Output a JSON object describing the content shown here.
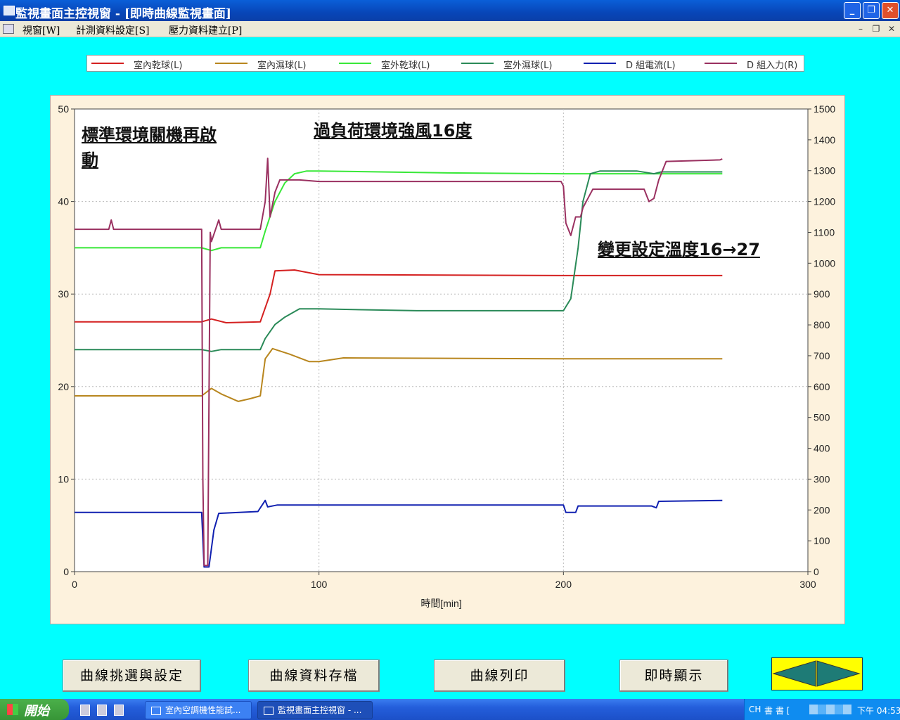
{
  "window": {
    "title": "監視畫面主控視窗 - [即時曲線監視畫面]",
    "minimize": "_",
    "restore": "❐",
    "close": "✕"
  },
  "menu": {
    "items": [
      "視窗[W]",
      "計測資料設定[S]",
      "壓力資料建立[P]"
    ],
    "mdi_min": "–",
    "mdi_restore": "❐",
    "mdi_close": "✕"
  },
  "legend": [
    {
      "label": "室內乾球(L)",
      "color": "#d42020"
    },
    {
      "label": "室內濕球(L)",
      "color": "#b8861e"
    },
    {
      "label": "室外乾球(L)",
      "color": "#38e838"
    },
    {
      "label": "室外濕球(L)",
      "color": "#2a8a58"
    },
    {
      "label": "D 組電流(L)",
      "color": "#1020b0"
    },
    {
      "label": "D 組入力(R)",
      "color": "#9a3060"
    }
  ],
  "annotations": {
    "a1_line1": "標準環境關機再啟",
    "a1_line2": "動",
    "a2": "過負荷環境強風16度",
    "a3": "變更設定溫度16→27"
  },
  "chart_data": {
    "type": "line",
    "xlabel": "時間[min]",
    "xlim": [
      0,
      300
    ],
    "ylim_left": [
      0,
      50
    ],
    "ylim_right": [
      0,
      1500
    ],
    "x_ticks": [
      0,
      100,
      200,
      300
    ],
    "y_left_ticks": [
      0,
      10,
      20,
      30,
      40,
      50
    ],
    "y_right_ticks": [
      0,
      100,
      200,
      300,
      400,
      500,
      600,
      700,
      800,
      900,
      1000,
      1100,
      1200,
      1300,
      1400,
      1500
    ],
    "grid": true,
    "series": [
      {
        "name": "室內乾球(L)",
        "axis": "left",
        "color": "#d42020",
        "points": [
          [
            0,
            27
          ],
          [
            52,
            27
          ],
          [
            56,
            27.3
          ],
          [
            62,
            26.9
          ],
          [
            76,
            27
          ],
          [
            80,
            30
          ],
          [
            82,
            32.5
          ],
          [
            90,
            32.6
          ],
          [
            100,
            32.1
          ],
          [
            200,
            32
          ],
          [
            265,
            32
          ]
        ]
      },
      {
        "name": "室內濕球(L)",
        "axis": "left",
        "color": "#b8861e",
        "points": [
          [
            0,
            19
          ],
          [
            52,
            19
          ],
          [
            56,
            19.8
          ],
          [
            60,
            19.2
          ],
          [
            67,
            18.4
          ],
          [
            72,
            18.7
          ],
          [
            76,
            19
          ],
          [
            78,
            23
          ],
          [
            81,
            24.1
          ],
          [
            88,
            23.5
          ],
          [
            96,
            22.7
          ],
          [
            100,
            22.7
          ],
          [
            110,
            23.1
          ],
          [
            200,
            23
          ],
          [
            265,
            23
          ]
        ]
      },
      {
        "name": "室外乾球(L)",
        "axis": "left",
        "color": "#38e838",
        "points": [
          [
            0,
            35
          ],
          [
            52,
            35
          ],
          [
            56,
            34.7
          ],
          [
            60,
            35
          ],
          [
            76,
            35
          ],
          [
            78,
            36.8
          ],
          [
            82,
            40
          ],
          [
            86,
            42
          ],
          [
            90,
            43
          ],
          [
            95,
            43.3
          ],
          [
            100,
            43.3
          ],
          [
            150,
            43.1
          ],
          [
            200,
            43
          ],
          [
            265,
            43
          ]
        ]
      },
      {
        "name": "室外濕球(L)",
        "axis": "left",
        "color": "#2a8a58",
        "points": [
          [
            0,
            24
          ],
          [
            52,
            24
          ],
          [
            56,
            23.8
          ],
          [
            60,
            24
          ],
          [
            76,
            24
          ],
          [
            78,
            25.2
          ],
          [
            82,
            26.7
          ],
          [
            86,
            27.5
          ],
          [
            92,
            28.4
          ],
          [
            100,
            28.4
          ],
          [
            140,
            28.2
          ],
          [
            200,
            28.2
          ],
          [
            203,
            29.5
          ],
          [
            206,
            35
          ],
          [
            208,
            40
          ],
          [
            211,
            43
          ],
          [
            215,
            43.3
          ],
          [
            230,
            43.3
          ],
          [
            237,
            43
          ],
          [
            240,
            43.2
          ],
          [
            265,
            43.2
          ]
        ]
      },
      {
        "name": "D 組電流(L)",
        "axis": "left",
        "color": "#1020b0",
        "points": [
          [
            0,
            6.4
          ],
          [
            52,
            6.4
          ],
          [
            53,
            0.5
          ],
          [
            55,
            0.5
          ],
          [
            57,
            4.5
          ],
          [
            59,
            6.3
          ],
          [
            75,
            6.5
          ],
          [
            78,
            7.7
          ],
          [
            79,
            7
          ],
          [
            83,
            7.2
          ],
          [
            100,
            7.2
          ],
          [
            200,
            7.2
          ],
          [
            201,
            6.4
          ],
          [
            205,
            6.4
          ],
          [
            206,
            7.1
          ],
          [
            236,
            7.1
          ],
          [
            238,
            6.9
          ],
          [
            239,
            7.6
          ],
          [
            265,
            7.7
          ]
        ]
      },
      {
        "name": "D 組入力(R)",
        "axis": "right",
        "color": "#9a3060",
        "points": [
          [
            0,
            1110
          ],
          [
            14,
            1110
          ],
          [
            15,
            1140
          ],
          [
            16,
            1110
          ],
          [
            52,
            1110
          ],
          [
            52.5,
            300
          ],
          [
            53,
            20
          ],
          [
            54.5,
            20
          ],
          [
            55.5,
            1100
          ],
          [
            56,
            1070
          ],
          [
            59,
            1140
          ],
          [
            60,
            1110
          ],
          [
            76,
            1110
          ],
          [
            78,
            1200
          ],
          [
            79,
            1340
          ],
          [
            80,
            1150
          ],
          [
            82,
            1230
          ],
          [
            84,
            1270
          ],
          [
            92,
            1270
          ],
          [
            100,
            1265
          ],
          [
            199,
            1265
          ],
          [
            200,
            1250
          ],
          [
            201,
            1130
          ],
          [
            203,
            1090
          ],
          [
            205,
            1150
          ],
          [
            207,
            1150
          ],
          [
            208,
            1180
          ],
          [
            210,
            1210
          ],
          [
            212,
            1240
          ],
          [
            233,
            1240
          ],
          [
            235,
            1200
          ],
          [
            237,
            1210
          ],
          [
            239,
            1270
          ],
          [
            242,
            1330
          ],
          [
            264,
            1335
          ],
          [
            265,
            1338
          ]
        ]
      }
    ]
  },
  "buttons": {
    "select": "曲線挑選與設定",
    "save": "曲線資料存檔",
    "print": "曲線列印",
    "realtime": "即時顯示"
  },
  "nav": {
    "prev": "◀",
    "next": "▶"
  },
  "taskbar": {
    "start": "開始",
    "tasks": [
      "室內空調機性能試...",
      "監視畫面主控視窗 - ..."
    ],
    "ime": "CH",
    "tray_text": "書 書 [",
    "clock": "下午 04:53"
  }
}
